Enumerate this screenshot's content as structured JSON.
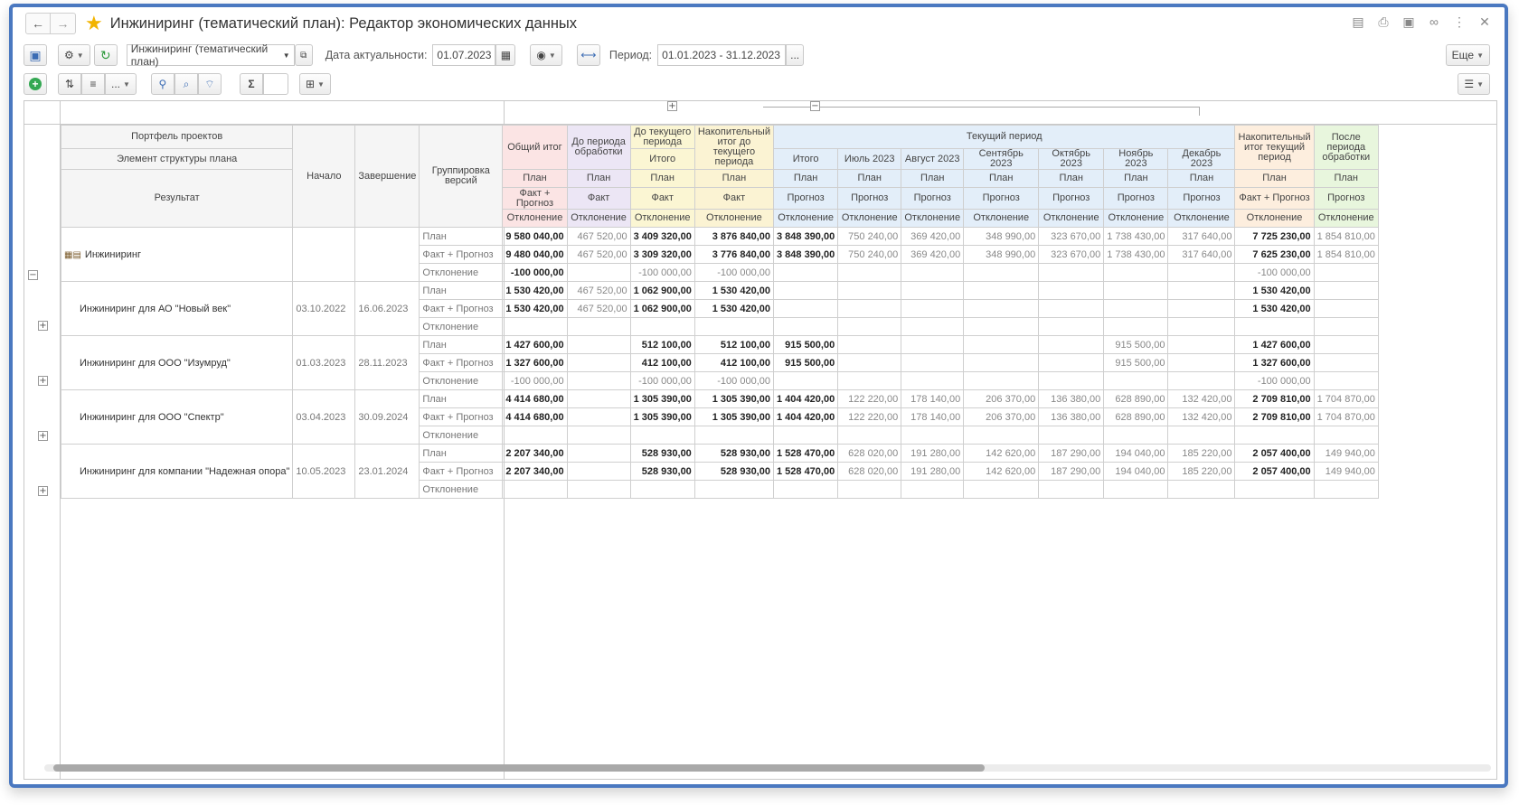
{
  "window": {
    "title": "Инжиниринг (тематический план): Редактор экономических данных"
  },
  "toolbar": {
    "plan_select": "Инжиниринг (тематический план)",
    "date_label": "Дата актуальности:",
    "date_value": "01.07.2023",
    "period_label": "Период:",
    "period_value": "01.01.2023 - 31.12.2023",
    "more_label": "Еще",
    "ellipsis": "...",
    "sigma": "Σ"
  },
  "header": {
    "portfolio": "Портфель проектов",
    "element": "Элемент структуры плана",
    "result": "Результат",
    "start": "Начало",
    "end": "Завершение",
    "grouping": "Группировка версий",
    "current_period": "Текущий период",
    "columns": [
      {
        "title": "Общий итог",
        "r1": "План",
        "r2": "Факт + Прогноз",
        "r3": "Отклонение"
      },
      {
        "title": "До периода обработки",
        "r1": "План",
        "r2": "Факт",
        "r3": "Отклонение"
      },
      {
        "title": "До текущего периода",
        "sub": "Итого",
        "r1": "План",
        "r2": "Факт",
        "r3": "Отклонение"
      },
      {
        "title": "Накопительный итог до текущего периода",
        "r1": "План",
        "r2": "Факт",
        "r3": "Отклонение"
      },
      {
        "sub": "Итого",
        "r1": "План",
        "r2": "Прогноз",
        "r3": "Отклонение"
      },
      {
        "sub": "Июль 2023",
        "r1": "План",
        "r2": "Прогноз",
        "r3": "Отклонение"
      },
      {
        "sub": "Август 2023",
        "r1": "План",
        "r2": "Прогноз",
        "r3": "Отклонение"
      },
      {
        "sub": "Сентябрь 2023",
        "r1": "План",
        "r2": "Прогноз",
        "r3": "Отклонение"
      },
      {
        "sub": "Октябрь 2023",
        "r1": "План",
        "r2": "Прогноз",
        "r3": "Отклонение"
      },
      {
        "sub": "Ноябрь 2023",
        "r1": "План",
        "r2": "Прогноз",
        "r3": "Отклонение"
      },
      {
        "sub": "Декабрь 2023",
        "r1": "План",
        "r2": "Прогноз",
        "r3": "Отклонение"
      },
      {
        "title": "Накопительный итог текущий период",
        "r1": "План",
        "r2": "Факт + Прогноз",
        "r3": "Отклонение"
      },
      {
        "title": "После периода обработки",
        "r1": "План",
        "r2": "Прогноз",
        "r3": "Отклонение"
      }
    ]
  },
  "rows": [
    {
      "name": "Инжиниринг",
      "start": "",
      "end": "",
      "lines": [
        {
          "kind": "План",
          "v": [
            "9 580 040,00",
            "467 520,00",
            "3 409 320,00",
            "3 876 840,00",
            "3 848 390,00",
            "750 240,00",
            "369 420,00",
            "348 990,00",
            "323 670,00",
            "1 738 430,00",
            "317 640,00",
            "7 725 230,00",
            "1 854 810,00"
          ]
        },
        {
          "kind": "Факт + Прогноз",
          "v": [
            "9 480 040,00",
            "467 520,00",
            "3 309 320,00",
            "3 776 840,00",
            "3 848 390,00",
            "750 240,00",
            "369 420,00",
            "348 990,00",
            "323 670,00",
            "1 738 430,00",
            "317 640,00",
            "7 625 230,00",
            "1 854 810,00"
          ]
        },
        {
          "kind": "Отклонение",
          "v": [
            "-100 000,00",
            "",
            "-100 000,00",
            "-100 000,00",
            "",
            "",
            "",
            "",
            "",
            "",
            "",
            "-100 000,00",
            ""
          ]
        }
      ]
    },
    {
      "name": "Инжиниринг для АО \"Новый век\"",
      "start": "03.10.2022",
      "end": "16.06.2023",
      "lines": [
        {
          "kind": "План",
          "v": [
            "1 530 420,00",
            "467 520,00",
            "1 062 900,00",
            "1 530 420,00",
            "",
            "",
            "",
            "",
            "",
            "",
            "",
            "1 530 420,00",
            ""
          ]
        },
        {
          "kind": "Факт + Прогноз",
          "v": [
            "1 530 420,00",
            "467 520,00",
            "1 062 900,00",
            "1 530 420,00",
            "",
            "",
            "",
            "",
            "",
            "",
            "",
            "1 530 420,00",
            ""
          ]
        },
        {
          "kind": "Отклонение",
          "v": [
            "",
            "",
            "",
            "",
            "",
            "",
            "",
            "",
            "",
            "",
            "",
            "",
            ""
          ]
        }
      ]
    },
    {
      "name": "Инжиниринг для ООО \"Изумруд\"",
      "start": "01.03.2023",
      "end": "28.11.2023",
      "lines": [
        {
          "kind": "План",
          "v": [
            "1 427 600,00",
            "",
            "512 100,00",
            "512 100,00",
            "915 500,00",
            "",
            "",
            "",
            "",
            "915 500,00",
            "",
            "1 427 600,00",
            ""
          ]
        },
        {
          "kind": "Факт + Прогноз",
          "v": [
            "1 327 600,00",
            "",
            "412 100,00",
            "412 100,00",
            "915 500,00",
            "",
            "",
            "",
            "",
            "915 500,00",
            "",
            "1 327 600,00",
            ""
          ]
        },
        {
          "kind": "Отклонение",
          "v": [
            "-100 000,00",
            "",
            "-100 000,00",
            "-100 000,00",
            "",
            "",
            "",
            "",
            "",
            "",
            "",
            "-100 000,00",
            ""
          ]
        }
      ]
    },
    {
      "name": "Инжиниринг для ООО \"Спектр\"",
      "start": "03.04.2023",
      "end": "30.09.2024",
      "lines": [
        {
          "kind": "План",
          "v": [
            "4 414 680,00",
            "",
            "1 305 390,00",
            "1 305 390,00",
            "1 404 420,00",
            "122 220,00",
            "178 140,00",
            "206 370,00",
            "136 380,00",
            "628 890,00",
            "132 420,00",
            "2 709 810,00",
            "1 704 870,00"
          ]
        },
        {
          "kind": "Факт + Прогноз",
          "v": [
            "4 414 680,00",
            "",
            "1 305 390,00",
            "1 305 390,00",
            "1 404 420,00",
            "122 220,00",
            "178 140,00",
            "206 370,00",
            "136 380,00",
            "628 890,00",
            "132 420,00",
            "2 709 810,00",
            "1 704 870,00"
          ]
        },
        {
          "kind": "Отклонение",
          "v": [
            "",
            "",
            "",
            "",
            "",
            "",
            "",
            "",
            "",
            "",
            "",
            "",
            ""
          ]
        }
      ]
    },
    {
      "name": "Инжиниринг для компании \"Надежная опора\"",
      "start": "10.05.2023",
      "end": "23.01.2024",
      "lines": [
        {
          "kind": "План",
          "v": [
            "2 207 340,00",
            "",
            "528 930,00",
            "528 930,00",
            "1 528 470,00",
            "628 020,00",
            "191 280,00",
            "142 620,00",
            "187 290,00",
            "194 040,00",
            "185 220,00",
            "2 057 400,00",
            "149 940,00"
          ]
        },
        {
          "kind": "Факт + Прогноз",
          "v": [
            "2 207 340,00",
            "",
            "528 930,00",
            "528 930,00",
            "1 528 470,00",
            "628 020,00",
            "191 280,00",
            "142 620,00",
            "187 290,00",
            "194 040,00",
            "185 220,00",
            "2 057 400,00",
            "149 940,00"
          ]
        },
        {
          "kind": "Отклонение",
          "v": [
            "",
            "",
            "",
            "",
            "",
            "",
            "",
            "",
            "",
            "",
            "",
            "",
            ""
          ]
        }
      ]
    }
  ]
}
